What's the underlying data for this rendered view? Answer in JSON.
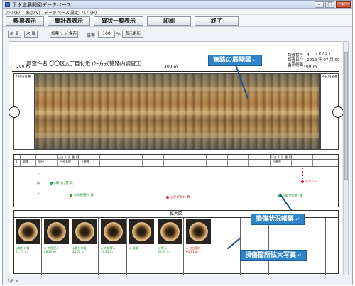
{
  "window": {
    "title": "下水道展開図データベース",
    "controls": {
      "minimize": "–",
      "maximize": "□",
      "close": "×"
    }
  },
  "menubar": [
    "ﾌｧｲﾙ(F)",
    "表示(V)",
    "データベース",
    "設定",
    "ﾍﾙﾌﾟ(H)"
  ],
  "toolbar": [
    "帳票表示",
    "集計表表示",
    "異状一覧表示",
    "印刷",
    "終了"
  ],
  "subbar": {
    "prev": "前 頁",
    "next": "次 頁",
    "save_image": "帳票ｲﾒｰｼﾞ保存",
    "zoom_label": "倍率",
    "zoom_value": "100",
    "zoom_unit": "%",
    "refresh": "表示更新"
  },
  "doc": {
    "title": "調査件名 〇〇区△丁目付近ｺﾗｰ方式管路内調査工",
    "survey_no_label": "調査番号 : 4",
    "page": "( 2 / 3 )",
    "survey_date": "調査日付 : 2012 年 07 月 09 日",
    "direction": "上流側面",
    "dist_start": "200 m",
    "dist_mid": "300 m",
    "dist_end": "400 m",
    "left_label": "人孔内名番",
    "right_label": "人孔内名番"
  },
  "grid": {
    "upstream": "上 流 人 孔 番 号",
    "downstream": "下 流 人 孔 番 号",
    "h_labels": [
      "1",
      "管種",
      "管径",
      "人孔名称",
      "土被厚",
      "土被厚"
    ],
    "row_labels": [
      "上",
      "中",
      "下"
    ]
  },
  "notes": [
    {
      "text": "◎取付け管 異",
      "tone": "green"
    },
    {
      "text": "◎木根侵入 異",
      "tone": "green"
    },
    {
      "text": "◎ひび割れ 異",
      "tone": "red"
    },
    {
      "text": "◎取付け管 異",
      "tone": "green"
    },
    {
      "text": "◎タルミ",
      "tone": "red"
    }
  ],
  "zoom_section_title": "拡大図",
  "photos": [
    {
      "cap": "◎取付け管\n21.71 m",
      "tone": "green"
    },
    {
      "cap": "① 木根侵入\n28.20 m",
      "tone": "green"
    },
    {
      "cap": "◎取付け管\n28.02 m",
      "tone": "green"
    },
    {
      "cap": "◎ 木根侵入\n37.82 m",
      "tone": "green"
    },
    {
      "cap": "◎ 破損",
      "tone": "green"
    },
    {
      "cap": "◎ 侵入\n50.03 m",
      "tone": "green"
    },
    {
      "cap": "◎ ひび割れ\n60.71 m",
      "tone": "red"
    }
  ],
  "callouts": {
    "pipe": "管路の展開図",
    "report": "損傷状況帳票",
    "photo": "損傷箇所拡大写真",
    "return_mark": "↵"
  },
  "status": "1/P < |"
}
